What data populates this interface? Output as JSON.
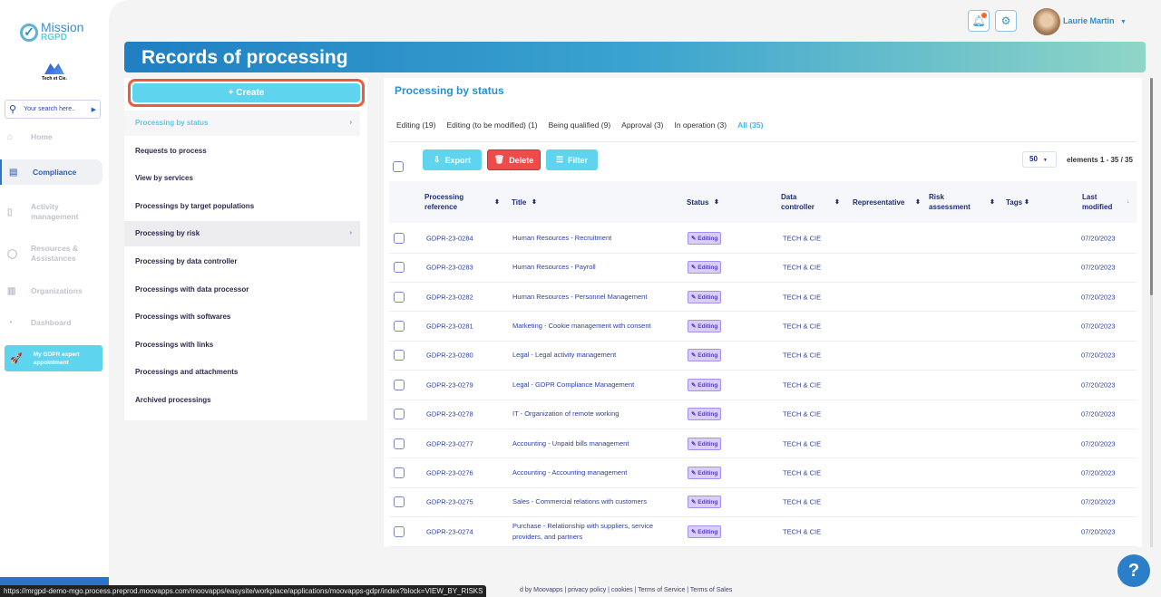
{
  "brand": {
    "name_line1": "Mission",
    "name_line2": "RGPD",
    "company": "Tech et Cie."
  },
  "search": {
    "placeholder": "Your search here.."
  },
  "nav": [
    {
      "label": "Home",
      "icon": "home-icon"
    },
    {
      "label": "Compliance",
      "icon": "document-icon"
    },
    {
      "label": "Activity management",
      "icon": "bookmark-icon"
    },
    {
      "label": "Resources & Assistances",
      "icon": "chat-icon"
    },
    {
      "label": "Organizations",
      "icon": "building-icon"
    },
    {
      "label": "Dashboard",
      "icon": "dashboard-icon"
    }
  ],
  "expert": {
    "label": "My GDPR expert appointment"
  },
  "user": {
    "name": "Laurie Martin"
  },
  "page_title": "Records of processing",
  "create_label": "+ Create",
  "left_menu": [
    "Processing by status",
    "Requests to process",
    "View by services",
    "Processings by target populations",
    "Processing by risk",
    "Processing by data controller",
    "Processings with data processor",
    "Processings with softwares",
    "Processings with links",
    "Processings and attachments",
    "Archived processings"
  ],
  "content": {
    "title": "Processing by status",
    "tabs": [
      "Editing (19)",
      "Editing (to be modified) (1)",
      "Being qualified (9)",
      "Approval (3)",
      "In operation (3)",
      "All (35)"
    ],
    "export": "Export",
    "delete": "Delete",
    "filter": "Filter",
    "per_page": "50",
    "elements": "elements 1 - 35 / 35",
    "columns": [
      "Processing reference",
      "Title",
      "Status",
      "Data controller",
      "Representative",
      "Risk assessment",
      "Tags",
      "Last modified"
    ],
    "rows": [
      [
        "GDPR-23-0284",
        "Human Resources - Recruitment",
        "Editing",
        "TECH & CIE",
        "07/20/2023"
      ],
      [
        "GDPR-23-0283",
        "Human Resources - Payroll",
        "Editing",
        "TECH & CIE",
        "07/20/2023"
      ],
      [
        "GDPR-23-0282",
        "Human Resources - Personnel Management",
        "Editing",
        "TECH & CIE",
        "07/20/2023"
      ],
      [
        "GDPR-23-0281",
        "Marketing - Cookie management with consent",
        "Editing",
        "TECH & CIE",
        "07/20/2023"
      ],
      [
        "GDPR-23-0280",
        "Legal - Legal activity management",
        "Editing",
        "TECH & CIE",
        "07/20/2023"
      ],
      [
        "GDPR-23-0279",
        "Legal - GDPR Compliance Management",
        "Editing",
        "TECH & CIE",
        "07/20/2023"
      ],
      [
        "GDPR-23-0278",
        "IT - Organization of remote working",
        "Editing",
        "TECH & CIE",
        "07/20/2023"
      ],
      [
        "GDPR-23-0277",
        "Accounting - Unpaid bills management",
        "Editing",
        "TECH & CIE",
        "07/20/2023"
      ],
      [
        "GDPR-23-0276",
        "Accounting - Accounting management",
        "Editing",
        "TECH & CIE",
        "07/20/2023"
      ],
      [
        "GDPR-23-0275",
        "Sales - Commercial relations with customers",
        "Editing",
        "TECH & CIE",
        "07/20/2023"
      ],
      [
        "GDPR-23-0274",
        "Purchase - Relationship with suppliers, service providers, and partners",
        "Editing",
        "TECH & CIE",
        "07/20/2023"
      ]
    ]
  },
  "status_url": "https://mrgpd-demo-mgo.process.preprod.moovapps.com/moovapps/easysite/workplace/applications/moovapps-gdpr/index?block=VIEW_BY_RISKS",
  "footer": "d by Moovapps | privacy policy | cookies | Terms of Service | Terms of Sales",
  "help": "?"
}
